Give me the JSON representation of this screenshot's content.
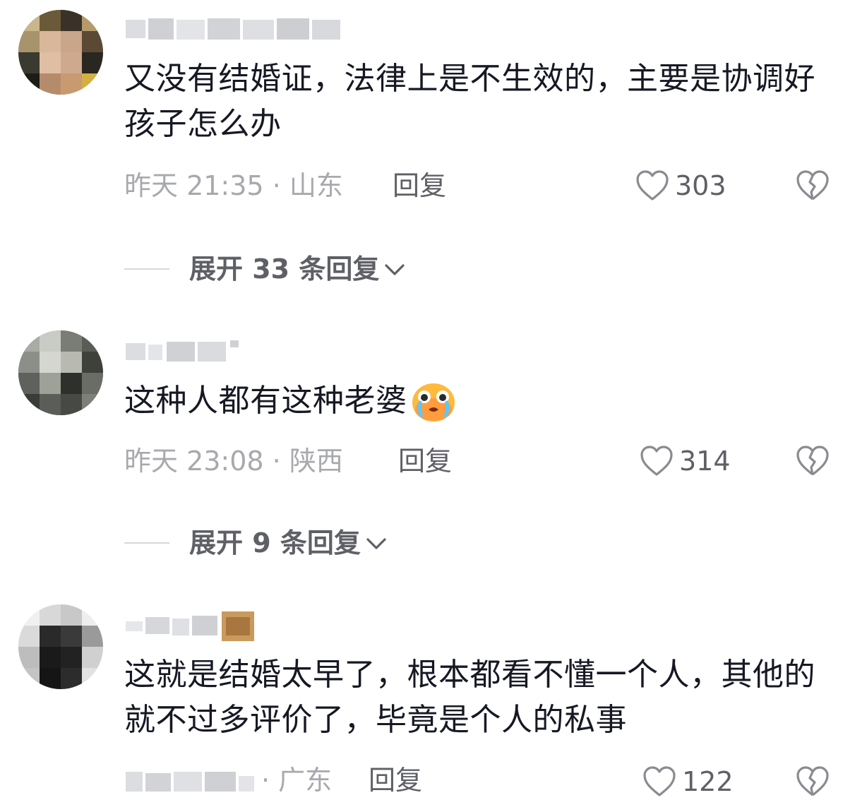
{
  "comments": [
    {
      "text": "又没有结婚证，法律上是不生效的，主要是协调好孩子怎么办",
      "time": "昨天 21:35 · 山东",
      "reply_label": "回复",
      "likes": "303",
      "expand_label": "展开 33 条回复"
    },
    {
      "text": "这种人都有这种老婆",
      "emoji": "crying-face-emoji",
      "time": "昨天 23:08 · 陕西",
      "reply_label": "回复",
      "likes": "314",
      "expand_label": "展开 9 条回复"
    },
    {
      "text": "这就是结婚太早了，根本都看不懂一个人，其他的就不过多评价了，毕竟是个人的私事",
      "time_suffix": "· 广东",
      "reply_label": "回复",
      "likes": "122"
    }
  ],
  "icons": {
    "like": "heart-outline-icon",
    "dislike": "broken-heart-icon",
    "expand": "chevron-down-icon"
  },
  "colors": {
    "text_primary": "#161823",
    "text_secondary": "#a8a9ad",
    "action_text": "#5f6066"
  }
}
